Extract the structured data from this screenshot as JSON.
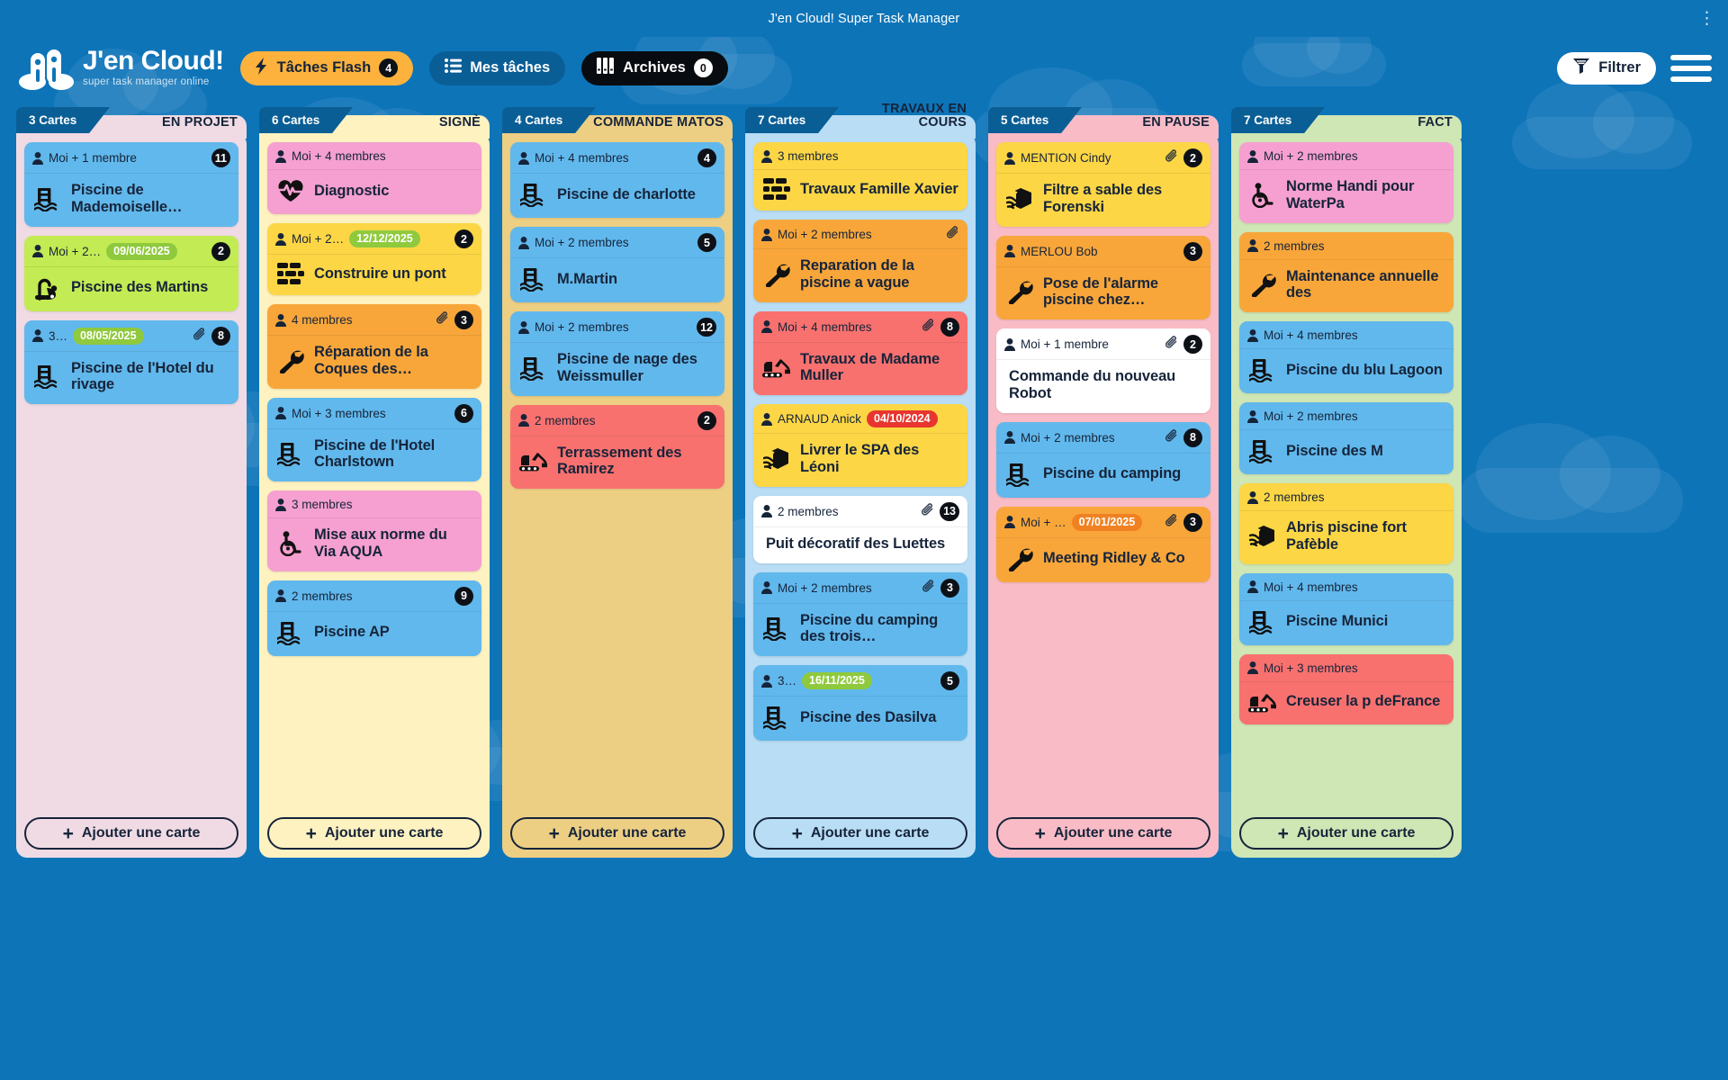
{
  "window": {
    "title": "J'en Cloud! Super Task Manager",
    "menu_icon": "kebab-menu-icon"
  },
  "header": {
    "brand_name": "J'en Cloud!",
    "brand_tagline": "super task manager online",
    "buttons": [
      {
        "id": "flash",
        "label": "Tâches Flash",
        "count": "4",
        "icon": "lightning-bolt-icon"
      },
      {
        "id": "mine",
        "label": "Mes tâches",
        "count": null,
        "icon": "list-icon"
      },
      {
        "id": "archives",
        "label": "Archives",
        "count": "0",
        "icon": "archive-boxes-icon"
      }
    ],
    "filter_label": "Filtrer",
    "filter_icon": "funnel-icon",
    "menu_icon": "hamburger-icon"
  },
  "board": {
    "add_card_label": "Ajouter une carte",
    "columns": [
      {
        "title": "EN PROJET",
        "count_label": "3 Cartes",
        "bg": "#f0dbe4",
        "cards": [
          {
            "member": "Moi + 1 membre",
            "date": null,
            "clip": false,
            "badge": "11",
            "title": "Piscine de Mademoiselle…",
            "icon": "pool-ladder-icon",
            "color": "#61b8ec"
          },
          {
            "member": "Moi + 2…",
            "date": "09/06/2025",
            "date_color": "#8fc93d",
            "clip": false,
            "badge": "2",
            "title": "Piscine des Martins",
            "icon": "vacuum-icon",
            "color": "#c3eb53"
          },
          {
            "member": "3…",
            "date": "08/05/2025",
            "date_color": "#8fc93d",
            "clip": true,
            "badge": "8",
            "title": "Piscine de l'Hotel du rivage",
            "icon": "pool-ladder-icon",
            "color": "#61b8ec"
          }
        ]
      },
      {
        "title": "SIGNÈ",
        "count_label": "6 Cartes",
        "bg": "#fdf2c0",
        "cards": [
          {
            "member": "Moi + 4 membres",
            "date": null,
            "clip": false,
            "badge": null,
            "title": "Diagnostic",
            "icon": "heartbeat-icon",
            "color": "#f5a0d0"
          },
          {
            "member": "Moi + 2…",
            "date": "12/12/2025",
            "date_color": "#8fc93d",
            "clip": false,
            "badge": "2",
            "title": "Construire un pont",
            "icon": "bricks-icon",
            "color": "#fcd645"
          },
          {
            "member": "4 membres",
            "date": null,
            "clip": true,
            "badge": "3",
            "title": "Réparation de la Coques des…",
            "icon": "wrench-icon",
            "color": "#f8a63a"
          },
          {
            "member": "Moi + 3 membres",
            "date": null,
            "clip": false,
            "badge": "6",
            "title": "Piscine de l'Hotel Charlstown",
            "icon": "pool-ladder-icon",
            "color": "#61b8ec"
          },
          {
            "member": "3 membres",
            "date": null,
            "clip": false,
            "badge": null,
            "title": "Mise aux norme du Via AQUA",
            "icon": "wheelchair-icon",
            "color": "#f5a0d0"
          },
          {
            "member": "2 membres",
            "date": null,
            "clip": false,
            "badge": "9",
            "title": "Piscine AP",
            "icon": "pool-ladder-icon",
            "color": "#61b8ec"
          }
        ]
      },
      {
        "title": "COMMANDE MATOS",
        "count_label": "4 Cartes",
        "bg": "#edcf84",
        "cards": [
          {
            "member": "Moi + 4 membres",
            "date": null,
            "clip": false,
            "badge": "4",
            "title": "Piscine de charlotte",
            "icon": "pool-ladder-icon",
            "color": "#61b8ec"
          },
          {
            "member": "Moi + 2 membres",
            "date": null,
            "clip": false,
            "badge": "5",
            "title": "M.Martin",
            "icon": "pool-ladder-icon",
            "color": "#61b8ec"
          },
          {
            "member": "Moi + 2 membres",
            "date": null,
            "clip": false,
            "badge": "12",
            "title": "Piscine de nage des Weissmuller",
            "icon": "pool-ladder-icon",
            "color": "#61b8ec"
          },
          {
            "member": "2 membres",
            "date": null,
            "clip": false,
            "badge": "2",
            "title": "Terrassement des Ramirez",
            "icon": "excavator-icon",
            "color": "#f8716f"
          }
        ]
      },
      {
        "title": "TRAVAUX EN COURS",
        "count_label": "7 Cartes",
        "bg": "#b8ddf5",
        "cards": [
          {
            "member": "3 membres",
            "date": null,
            "clip": false,
            "badge": null,
            "title": "Travaux Famille Xavier",
            "icon": "bricks-icon",
            "color": "#fcd645"
          },
          {
            "member": "Moi + 2 membres",
            "date": null,
            "clip": true,
            "badge": null,
            "title": "Reparation de la piscine a vague",
            "icon": "wrench-icon",
            "color": "#f8a63a"
          },
          {
            "member": "Moi + 4 membres",
            "date": null,
            "clip": true,
            "badge": "8",
            "title": "Travaux de Madame Muller",
            "icon": "excavator-icon",
            "color": "#f8716f"
          },
          {
            "member": "ARNAUD Anick",
            "date": "04/10/2024",
            "date_color": "#e8352e",
            "clip": false,
            "badge": null,
            "title": "Livrer le SPA des Léoni",
            "icon": "delivery-hands-icon",
            "color": "#fcd645"
          },
          {
            "member": "2 membres",
            "date": null,
            "clip": true,
            "badge": "13",
            "title": "Puit décoratif des Luettes",
            "icon": null,
            "color": "#ffffff"
          },
          {
            "member": "Moi + 2 membres",
            "date": null,
            "clip": true,
            "badge": "3",
            "title": "Piscine du camping des trois…",
            "icon": "pool-ladder-icon",
            "color": "#61b8ec"
          },
          {
            "member": "3…",
            "date": "16/11/2025",
            "date_color": "#8fc93d",
            "clip": false,
            "badge": "5",
            "title": "Piscine des Dasilva",
            "icon": "pool-ladder-icon",
            "color": "#61b8ec"
          }
        ]
      },
      {
        "title": "EN PAUSE",
        "count_label": "5 Cartes",
        "bg": "#f9bcc6",
        "cards": [
          {
            "member": "MENTION Cindy",
            "date": null,
            "clip": true,
            "badge": "2",
            "title": "Filtre a sable des Forenski",
            "icon": "delivery-hands-icon",
            "color": "#fcd645"
          },
          {
            "member": "MERLOU Bob",
            "date": null,
            "clip": false,
            "badge": "3",
            "title": "Pose de l'alarme piscine chez…",
            "icon": "wrench-icon",
            "color": "#f8a63a"
          },
          {
            "member": "Moi + 1 membre",
            "date": null,
            "clip": true,
            "badge": "2",
            "title": "Commande du nouveau Robot",
            "icon": null,
            "color": "#ffffff"
          },
          {
            "member": "Moi + 2 membres",
            "date": null,
            "clip": true,
            "badge": "8",
            "title": "Piscine du camping",
            "icon": "pool-ladder-icon",
            "color": "#61b8ec"
          },
          {
            "member": "Moi + …",
            "date": "07/01/2025",
            "date_color": "#f08122",
            "clip": true,
            "badge": "3",
            "title": "Meeting Ridley & Co",
            "icon": "wrench-icon",
            "color": "#f8a63a"
          }
        ]
      },
      {
        "title": "FACT",
        "count_label": "7 Cartes",
        "bg": "#cfe6b5",
        "cards": [
          {
            "member": "Moi + 2 membres",
            "date": null,
            "clip": false,
            "badge": null,
            "title": "Norme Handi pour WaterPa",
            "icon": "wheelchair-icon",
            "color": "#f5a0d0"
          },
          {
            "member": "2 membres",
            "date": null,
            "clip": false,
            "badge": null,
            "title": "Maintenance annuelle des",
            "icon": "wrench-icon",
            "color": "#f8a63a"
          },
          {
            "member": "Moi + 4 membres",
            "date": null,
            "clip": false,
            "badge": null,
            "title": "Piscine du blu Lagoon",
            "icon": "pool-ladder-icon",
            "color": "#61b8ec"
          },
          {
            "member": "Moi + 2 membres",
            "date": null,
            "clip": false,
            "badge": null,
            "title": "Piscine des M",
            "icon": "pool-ladder-icon",
            "color": "#61b8ec"
          },
          {
            "member": "2 membres",
            "date": null,
            "clip": false,
            "badge": null,
            "title": "Abris piscine fort Pafèble",
            "icon": "delivery-hands-icon",
            "color": "#fcd645"
          },
          {
            "member": "Moi + 4 membres",
            "date": null,
            "clip": false,
            "badge": null,
            "title": "Piscine Munici",
            "icon": "pool-ladder-icon",
            "color": "#61b8ec"
          },
          {
            "member": "Moi + 3 membres",
            "date": null,
            "clip": false,
            "badge": null,
            "title": "Creuser la p deFrance",
            "icon": "excavator-icon",
            "color": "#f8716f"
          }
        ]
      }
    ]
  }
}
